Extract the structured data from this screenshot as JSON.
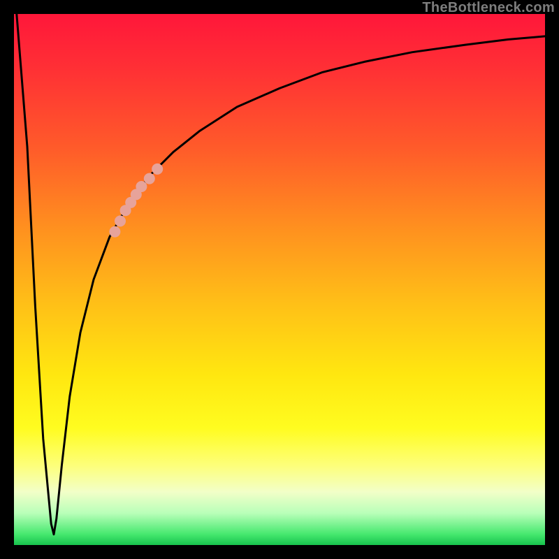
{
  "attribution": "TheBottleneck.com",
  "chart_data": {
    "type": "line",
    "title": "",
    "xlabel": "",
    "ylabel": "",
    "xlim": [
      0,
      100
    ],
    "ylim": [
      0,
      100
    ],
    "grid": false,
    "legend": false,
    "gradient_stops": [
      {
        "pct": 0,
        "color": "#ff173a"
      },
      {
        "pct": 25,
        "color": "#ff5a2a"
      },
      {
        "pct": 55,
        "color": "#ffc117"
      },
      {
        "pct": 78,
        "color": "#fffc20"
      },
      {
        "pct": 90,
        "color": "#f2ffc8"
      },
      {
        "pct": 100,
        "color": "#17c24d"
      }
    ],
    "series": [
      {
        "name": "bottleneck-curve",
        "x": [
          0.5,
          2.5,
          4,
          5.5,
          7,
          7.5,
          8,
          9,
          10.5,
          12.5,
          15,
          18,
          22,
          26,
          30,
          35,
          42,
          50,
          58,
          66,
          75,
          85,
          93,
          100
        ],
        "y": [
          100,
          75,
          45,
          20,
          4,
          2,
          5,
          15,
          28,
          40,
          50,
          58,
          65,
          70,
          74,
          78,
          82.5,
          86,
          89,
          91,
          92.8,
          94.2,
          95.2,
          95.8
        ],
        "color": "#000000",
        "width": 2
      }
    ],
    "highlight_segment": {
      "color": "#e7a39a",
      "points": [
        {
          "x": 19.0,
          "y": 59.0
        },
        {
          "x": 20.0,
          "y": 61.0
        },
        {
          "x": 21.0,
          "y": 63.0
        },
        {
          "x": 22.0,
          "y": 64.5
        },
        {
          "x": 23.0,
          "y": 66.0
        },
        {
          "x": 24.0,
          "y": 67.5
        },
        {
          "x": 25.5,
          "y": 69.0
        },
        {
          "x": 27.0,
          "y": 70.8
        }
      ],
      "gap_after_index": 5
    }
  }
}
